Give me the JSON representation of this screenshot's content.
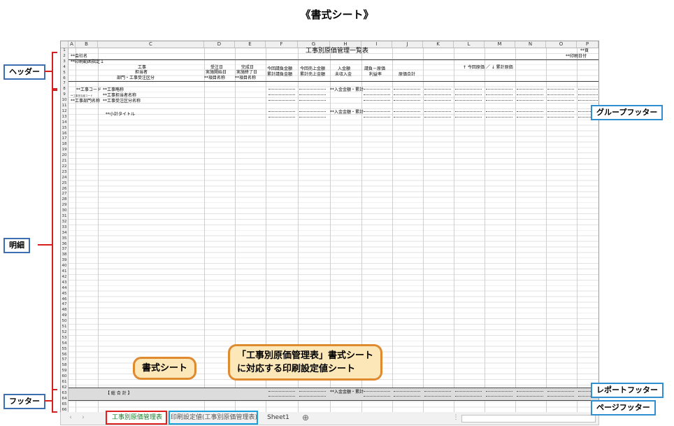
{
  "page_title": "《書式シート》",
  "columns": [
    "A",
    "B",
    "C",
    "D",
    "E",
    "F",
    "G",
    "H",
    "I",
    "J",
    "K",
    "L",
    "M",
    "N",
    "O",
    "P"
  ],
  "sheet": {
    "title": "工事別原価管理一覧表",
    "company": "**会社名",
    "print_range": "**印刷範囲指定１",
    "page_no": "**頁",
    "print_date": "**印刷日付",
    "hdr_c": [
      "工事",
      "担当者",
      "部門・工事受注区分"
    ],
    "hdr_d": [
      "受注日",
      "実施開始日",
      "**項目名称"
    ],
    "hdr_e": [
      "完成日",
      "実施終了日",
      "**項目名称"
    ],
    "hdr_f": [
      "今回請負金額",
      "累計請負金額"
    ],
    "hdr_g": [
      "今回売上金額",
      "累計売上金額"
    ],
    "hdr_h": [
      "入金額",
      "未収入金"
    ],
    "hdr_i": [
      "請負－原価",
      "利益率"
    ],
    "hdr_group": "↑ 今回原価 ／ ↓ 累計原価",
    "hdr_j": "原価合計",
    "row_b": [
      "**工事コード",
      "**工事担当者コード",
      "**工事部門名称"
    ],
    "row_c": [
      "**工事略称",
      "**工事担当者名称",
      "**工事受注区分名称"
    ],
    "subtotal": "**小計タイトル",
    "grand_total": "【 総 合 計 】",
    "amount": "**入金金額・累計"
  },
  "tabs": [
    "工事別原価管理表",
    "印刷設定値(工事別原価管理表)",
    "Sheet1"
  ],
  "labels": {
    "header": "ヘッダー",
    "detail": "明細",
    "footer": "フッター",
    "group_footer": "グループフッター",
    "report_footer": "レポートフッター",
    "page_footer": "ページフッター"
  },
  "callouts": {
    "format_sheet": "書式シート",
    "print_settings": [
      "「工事別原価管理表」書式シート",
      "に対応する印刷設定値シート"
    ]
  }
}
